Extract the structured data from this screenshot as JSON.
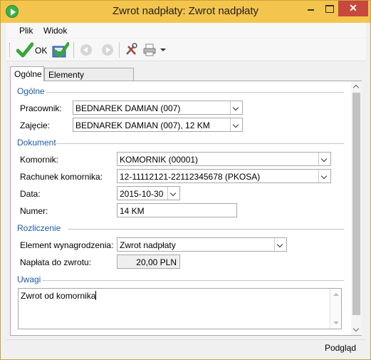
{
  "window": {
    "title": "Zwrot nadpłaty: Zwrot nadpłaty",
    "close_glyph": "✕"
  },
  "menu": [
    {
      "label": "Plik"
    },
    {
      "label": "Widok"
    }
  ],
  "toolbar": {
    "ok_label": "OK",
    "icons": [
      "ok-check-icon",
      "save-check-icon",
      "back-arrow-icon",
      "forward-arrow-icon",
      "tools-icon",
      "printer-icon"
    ]
  },
  "tabs": [
    {
      "label": "Ogólne",
      "active": true
    },
    {
      "label": "Elementy wynagrodzenia",
      "active": false
    }
  ],
  "sections": {
    "general": "Ogólne",
    "document": "Dokument",
    "settlement": "Rozliczenie",
    "notes": "Uwagi"
  },
  "fields": {
    "employee": {
      "label": "Pracownik:",
      "value": "BEDNAREK DAMIAN (007)"
    },
    "job": {
      "label": "Zajęcie:",
      "value": "BEDNAREK DAMIAN (007), 12 KM"
    },
    "bailiff": {
      "label": "Komornik:",
      "value": "KOMORNIK (00001)"
    },
    "bailiff_account": {
      "label": "Rachunek komornika:",
      "value": "12-11112121-22112345678 (PKOSA)"
    },
    "date": {
      "label": "Data:",
      "value": "2015-10-30"
    },
    "number": {
      "label": "Numer:",
      "value": "14 KM"
    },
    "salary_element": {
      "label": "Element wynagrodzenia:",
      "value": "Zwrot nadpłaty"
    },
    "refund": {
      "label": "Napłata do zwrotu:",
      "value": "20,00 PLN"
    }
  },
  "notes": "Zwrot od komornika",
  "status": "Podgląd",
  "colors": {
    "titlebar": "#f4c54c",
    "section_header": "#1e5aa8",
    "close_button": "#c7483d",
    "check_green": "#3aa63a"
  }
}
